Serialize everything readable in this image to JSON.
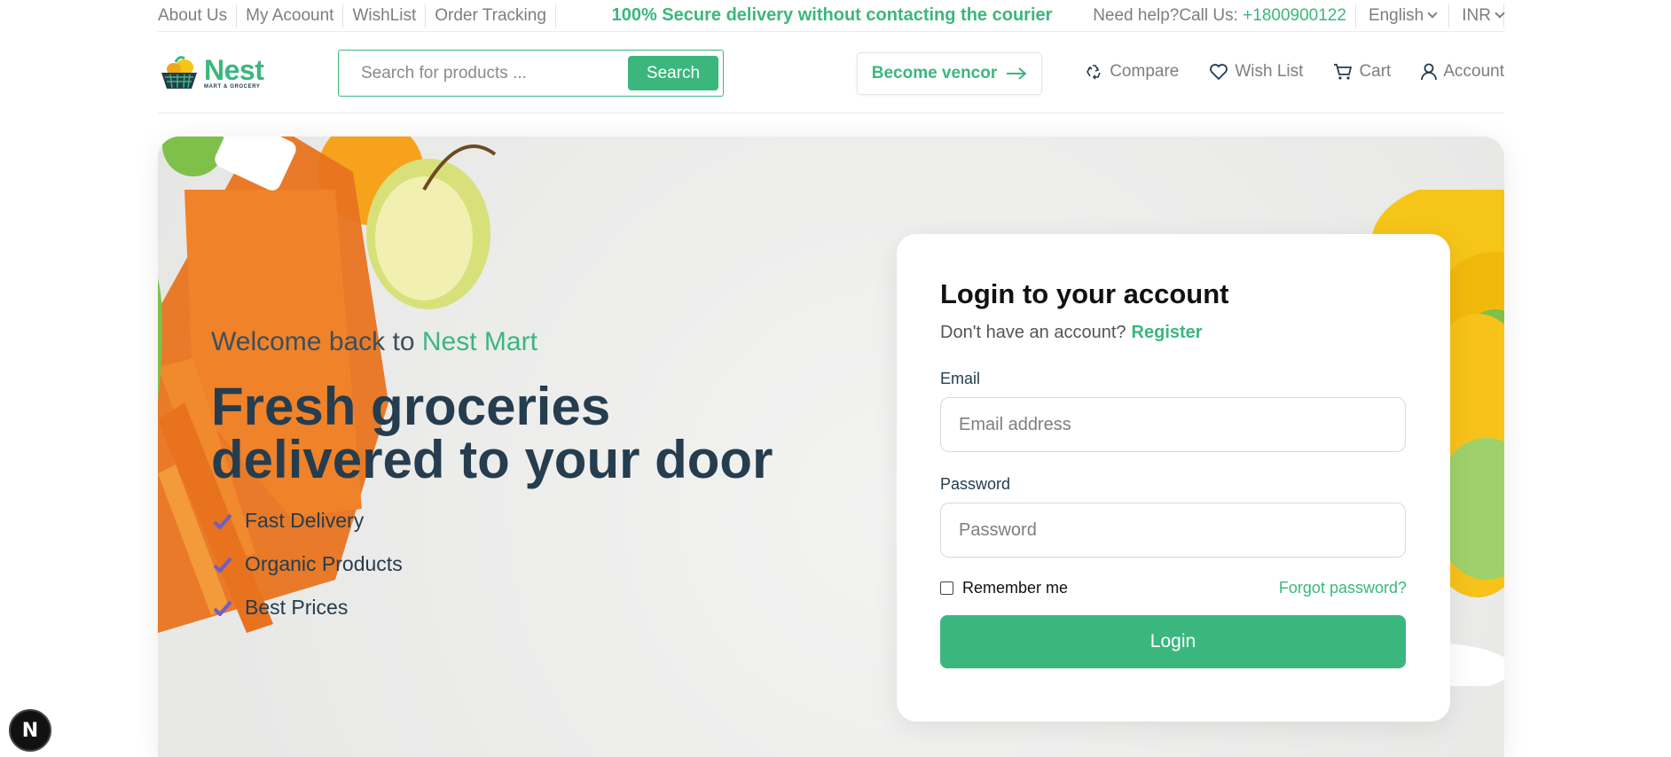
{
  "topbar": {
    "links": [
      "About Us",
      "My Acoount",
      "WishList",
      "Order Tracking"
    ],
    "promo": "100% Secure delivery without contacting the courier",
    "help_text": "Need help?Call Us: ",
    "phone": "+1800900122",
    "language": "English",
    "currency": "INR"
  },
  "header": {
    "logo_name": "Nest",
    "logo_tagline": "MART & GROCERY",
    "search_placeholder": "Search for products ...",
    "search_button": "Search",
    "vendor_button": "Become vencor",
    "actions": {
      "compare": "Compare",
      "wishlist": "Wish List",
      "cart": "Cart",
      "account": "Account"
    }
  },
  "hero": {
    "welcome_prefix": "Welcome back to ",
    "welcome_brand": "Nest Mart",
    "headline": "Fresh groceries delivered to your door",
    "features": [
      "Fast Delivery",
      "Organic Products",
      "Best Prices"
    ]
  },
  "login": {
    "title": "Login to your account",
    "no_account": "Don't have an account?",
    "register": "Register",
    "email_label": "Email",
    "email_placeholder": "Email address",
    "password_label": "Password",
    "password_placeholder": "Password",
    "remember": "Remember me",
    "forgot": "Forgot password?",
    "submit": "Login"
  },
  "badge": "N",
  "colors": {
    "accent": "#3bb77e",
    "heading": "#253d4e",
    "check": "#6c5fc7"
  }
}
